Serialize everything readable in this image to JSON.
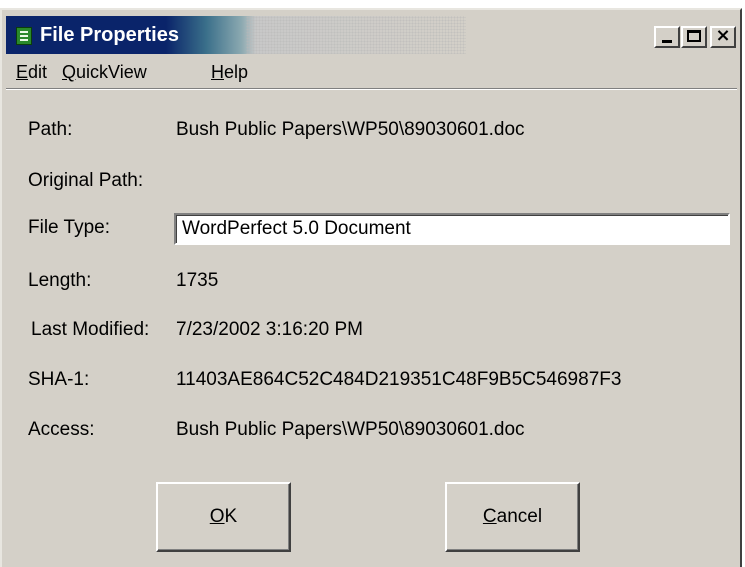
{
  "window": {
    "title": "File Properties",
    "icon": "document-green-icon",
    "controls": {
      "minimize": "minimize-icon",
      "maximize": "maximize-icon",
      "close": "close-icon"
    }
  },
  "menu": {
    "edit": {
      "mnemonic": "E",
      "rest": "dit"
    },
    "quickview": {
      "mnemonic": "Q",
      "rest": "uickView"
    },
    "help": {
      "mnemonic": "H",
      "rest": "elp"
    }
  },
  "fields": {
    "path": {
      "label": "Path:",
      "value": "Bush Public Papers\\WP50\\89030601.doc"
    },
    "original_path": {
      "label": "Original Path:",
      "value": ""
    },
    "file_type": {
      "label": "File Type:",
      "value": "WordPerfect 5.0 Document"
    },
    "length": {
      "label": "Length:",
      "value": "1735"
    },
    "last_modified": {
      "label": "Last Modified:",
      "value": "7/23/2002 3:16:20 PM"
    },
    "sha1": {
      "label": "SHA-1:",
      "value": "11403AE864C52C484D219351C48F9B5C546987F3"
    },
    "access": {
      "label": "Access:",
      "value": "Bush Public Papers\\WP50\\89030601.doc"
    }
  },
  "buttons": {
    "ok": {
      "mnemonic": "O",
      "rest": "K"
    },
    "cancel": {
      "mnemonic": "C",
      "rest": "ancel"
    }
  },
  "colors": {
    "titlebar_active": "#0a246a",
    "dialog_face": "#d4d0c8"
  }
}
